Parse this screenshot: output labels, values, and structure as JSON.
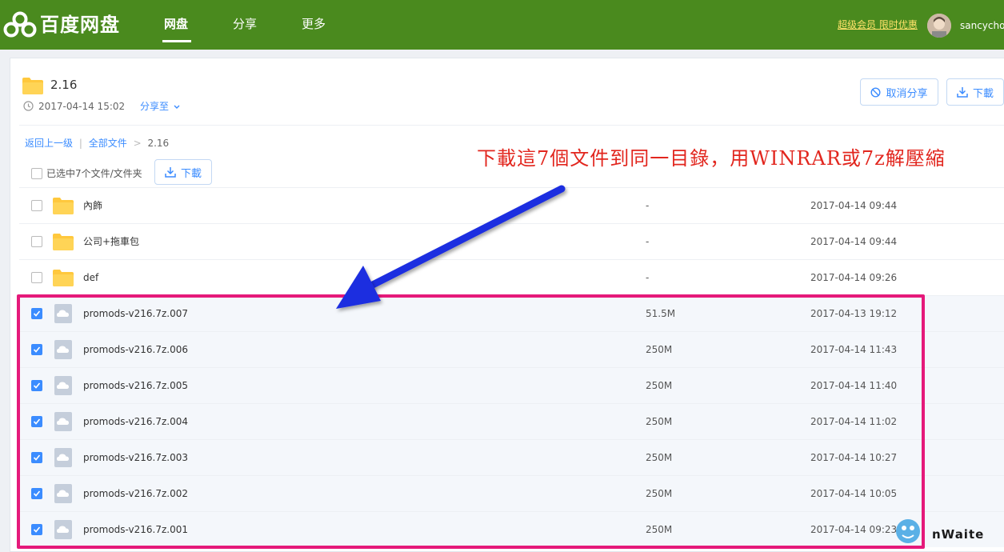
{
  "header": {
    "logo_text": "百度网盘",
    "nav": [
      {
        "label": "网盘",
        "active": true
      },
      {
        "label": "分享",
        "active": false
      },
      {
        "label": "更多",
        "active": false
      }
    ],
    "vip_link": "超级会员 限时优惠",
    "username": "sancychou"
  },
  "folder": {
    "name": "2.16",
    "created": "2017-04-14 15:02",
    "share_to": "分享至"
  },
  "actions": {
    "cancel_share": "取消分享",
    "download": "下載"
  },
  "breadcrumb": {
    "back": "返回上一级",
    "sep1": "|",
    "all_files": "全部文件",
    "sep2": ">",
    "current": "2.16"
  },
  "selection": {
    "label": "已选中7个文件/文件夹",
    "download": "下載"
  },
  "annotation_text": "下載這7個文件到同一目錄，用WINRAR或7z解壓縮",
  "files": [
    {
      "name": "內飾",
      "size": "-",
      "time": "2017-04-14 09:44",
      "type": "folder",
      "checked": false
    },
    {
      "name": "公司+拖車包",
      "size": "-",
      "time": "2017-04-14 09:44",
      "type": "folder",
      "checked": false
    },
    {
      "name": "def",
      "size": "-",
      "time": "2017-04-14 09:26",
      "type": "folder",
      "checked": false
    },
    {
      "name": "promods-v216.7z.007",
      "size": "51.5M",
      "time": "2017-04-13 19:12",
      "type": "file",
      "checked": true
    },
    {
      "name": "promods-v216.7z.006",
      "size": "250M",
      "time": "2017-04-14 11:43",
      "type": "file",
      "checked": true
    },
    {
      "name": "promods-v216.7z.005",
      "size": "250M",
      "time": "2017-04-14 11:40",
      "type": "file",
      "checked": true
    },
    {
      "name": "promods-v216.7z.004",
      "size": "250M",
      "time": "2017-04-14 11:02",
      "type": "file",
      "checked": true
    },
    {
      "name": "promods-v216.7z.003",
      "size": "250M",
      "time": "2017-04-14 10:27",
      "type": "file",
      "checked": true
    },
    {
      "name": "promods-v216.7z.002",
      "size": "250M",
      "time": "2017-04-14 10:05",
      "type": "file",
      "checked": true
    },
    {
      "name": "promods-v216.7z.001",
      "size": "250M",
      "time": "2017-04-14 09:23",
      "type": "file",
      "checked": true
    }
  ],
  "watermark": "nWaite",
  "colors": {
    "header_bg": "#4a8a1e",
    "accent": "#3b8cff",
    "highlight": "#e5197a",
    "annotation": "#e2261e",
    "arrow": "#1f2fe0"
  }
}
